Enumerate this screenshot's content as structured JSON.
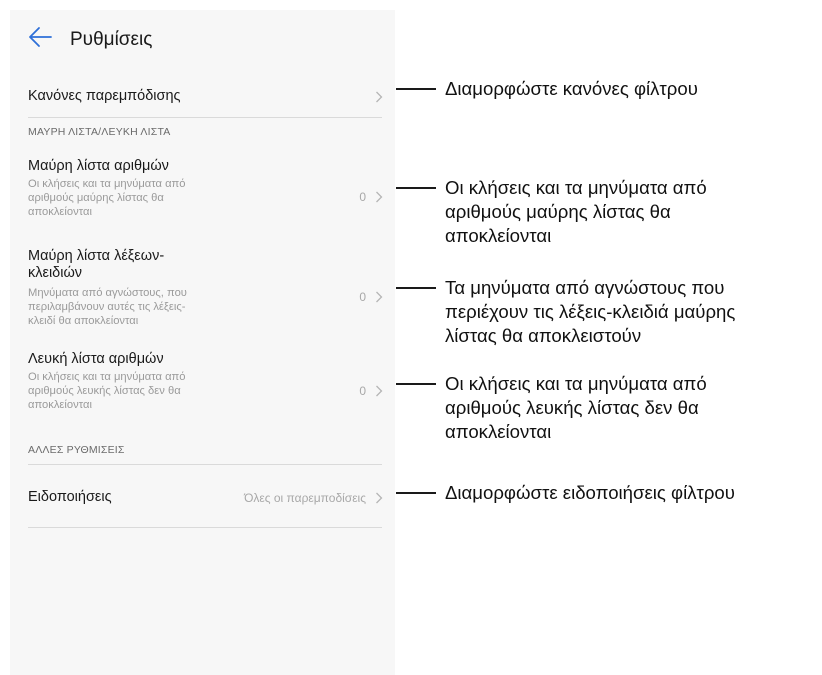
{
  "header": {
    "title": "Ρυθμίσεις",
    "back_icon": "arrow-left-icon"
  },
  "rows": {
    "blocking_rules": {
      "title": "Κανόνες παρεμπόδισης"
    },
    "number_blacklist": {
      "title": "Μαύρη λίστα αριθμών",
      "subtitle_lines": [
        "Οι κλήσεις και τα μηνύματα από",
        "αριθμούς μαύρης λίστας θα",
        "αποκλείονται"
      ],
      "count": "0"
    },
    "keyword_blacklist": {
      "title_lines": [
        "Μαύρη λίστα λέξεων-",
        "κλειδιών"
      ],
      "subtitle_lines": [
        "Μηνύματα από αγνώστους, που",
        "περιλαμβάνουν αυτές τις λέξεις-",
        "κλειδί θα αποκλείονται"
      ],
      "count": "0"
    },
    "number_whitelist": {
      "title": "Λευκή λίστα αριθμών",
      "subtitle_lines": [
        "Οι κλήσεις και τα μηνύματα από",
        "αριθμούς λευκής λίστας δεν θα",
        "αποκλείονται"
      ],
      "count": "0"
    },
    "notifications": {
      "title": "Ειδοποιήσεις",
      "value": "Όλες οι παρεμποδίσεις"
    }
  },
  "sections": {
    "blacklist_whitelist": "ΜΑΥΡΗ ΛΙΣΤΑ/ΛΕΥΚΗ ΛΙΣΤΑ",
    "other_settings": "ΑΛΛΕΣ ΡΥΘΜΙΣΕΙΣ"
  },
  "callouts": {
    "blocking_rules": [
      "Διαμορφώστε κανόνες φίλτρου"
    ],
    "number_blacklist": [
      "Οι κλήσεις και τα μηνύματα από",
      "αριθμούς μαύρης λίστας θα",
      "αποκλείονται"
    ],
    "keyword_blacklist": [
      "Τα μηνύματα από αγνώστους που",
      "περιέχουν τις λέξεις-κλειδιά μαύρης",
      "λίστας θα αποκλειστούν"
    ],
    "number_whitelist": [
      "Οι κλήσεις και τα μηνύματα από",
      "αριθμούς λευκής λίστας δεν θα",
      "αποκλείονται"
    ],
    "notifications": [
      "Διαμορφώστε ειδοποιήσεις φίλτρου"
    ]
  },
  "colors": {
    "accent": "#2e6fd8",
    "text": "#1a1a1a",
    "secondary": "#9a9a9a"
  }
}
